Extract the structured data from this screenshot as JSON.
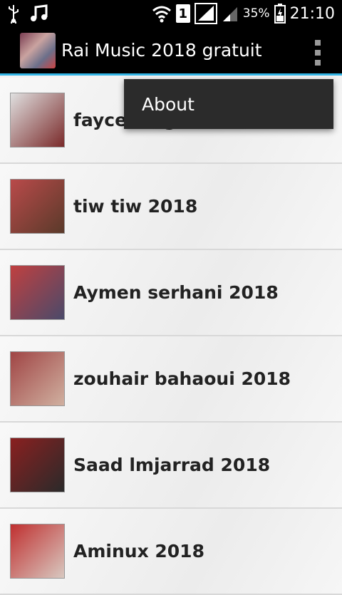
{
  "status_bar": {
    "battery_percent": "35%",
    "time": "21:10",
    "sim_slot": "1",
    "icons": [
      "usb-icon",
      "music-note-icon",
      "wifi-icon",
      "sim-icon",
      "signal-icon",
      "signal-icon",
      "battery-icon"
    ]
  },
  "app": {
    "title": "Rai Music 2018 gratuit"
  },
  "menu": {
    "items": [
      {
        "label": "About"
      }
    ]
  },
  "list": {
    "items": [
      {
        "label": "faycel mignon 2018",
        "thumb_colors": [
          "#e0e0e0",
          "#7a2a2a"
        ]
      },
      {
        "label": "tiw tiw 2018",
        "thumb_colors": [
          "#b94a4a",
          "#5a3a2a"
        ]
      },
      {
        "label": "Aymen serhani 2018",
        "thumb_colors": [
          "#c04040",
          "#4a4a6a"
        ]
      },
      {
        "label": "zouhair bahaoui 2018",
        "thumb_colors": [
          "#a04545",
          "#d0b0a0"
        ]
      },
      {
        "label": "Saad lmjarrad 2018",
        "thumb_colors": [
          "#8a2020",
          "#2a2a2a"
        ]
      },
      {
        "label": "Aminux 2018",
        "thumb_colors": [
          "#c03030",
          "#d8c8c0"
        ]
      }
    ]
  }
}
